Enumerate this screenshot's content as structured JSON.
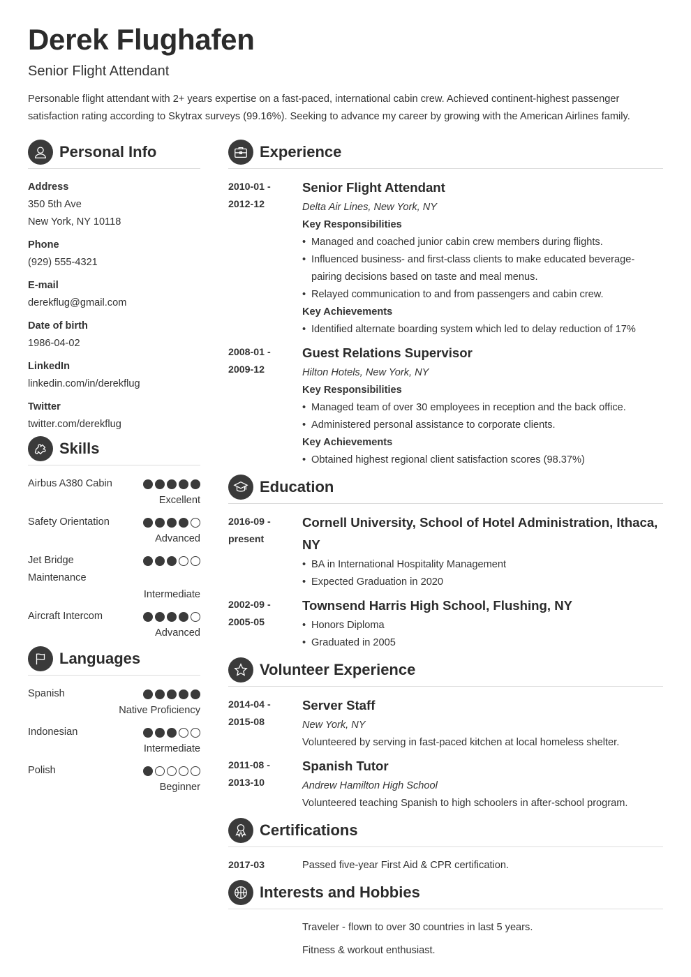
{
  "header": {
    "name": "Derek Flughafen",
    "title": "Senior Flight Attendant",
    "summary": "Personable flight attendant with 2+ years expertise on a fast-paced, international cabin crew. Achieved continent-highest passenger satisfaction rating according to Skytrax surveys (99.16%). Seeking to advance my career by growing with the American Airlines family."
  },
  "personal_info": {
    "heading": "Personal Info",
    "icon": "user-icon",
    "items": [
      {
        "label": "Address",
        "lines": [
          "350 5th Ave",
          "New York, NY 10118"
        ]
      },
      {
        "label": "Phone",
        "lines": [
          "(929) 555-4321"
        ]
      },
      {
        "label": "E-mail",
        "lines": [
          "derekflug@gmail.com"
        ]
      },
      {
        "label": "Date of birth",
        "lines": [
          "1986-04-02"
        ]
      },
      {
        "label": "LinkedIn",
        "lines": [
          "linkedin.com/in/derekflug"
        ]
      },
      {
        "label": "Twitter",
        "lines": [
          "twitter.com/derekflug"
        ]
      }
    ]
  },
  "skills": {
    "heading": "Skills",
    "icon": "puzzle-icon",
    "max": 5,
    "items": [
      {
        "name": "Airbus A380 Cabin",
        "rating": 5,
        "level": "Excellent"
      },
      {
        "name": "Safety Orientation",
        "rating": 4,
        "level": "Advanced"
      },
      {
        "name": "Jet Bridge Maintenance",
        "rating": 3,
        "level": "Intermediate"
      },
      {
        "name": "Aircraft Intercom",
        "rating": 4,
        "level": "Advanced"
      }
    ]
  },
  "languages": {
    "heading": "Languages",
    "icon": "flag-icon",
    "max": 5,
    "items": [
      {
        "name": "Spanish",
        "rating": 5,
        "level": "Native Proficiency"
      },
      {
        "name": "Indonesian",
        "rating": 3,
        "level": "Intermediate"
      },
      {
        "name": "Polish",
        "rating": 1,
        "level": "Beginner"
      }
    ]
  },
  "experience": {
    "heading": "Experience",
    "icon": "briefcase-icon",
    "entries": [
      {
        "date_start": "2010-01 -",
        "date_end": "2012-12",
        "title": "Senior Flight Attendant",
        "subtitle": "Delta Air Lines, New York, NY",
        "resp_label": "Key Responsibilities",
        "responsibilities": [
          "Managed and coached junior cabin crew members during flights.",
          "Influenced business- and first-class clients to make educated beverage-pairing decisions based on taste and meal menus.",
          "Relayed communication to and from passengers and cabin crew."
        ],
        "ach_label": "Key Achievements",
        "achievements": [
          "Identified alternate boarding system which led to delay reduction of 17%"
        ]
      },
      {
        "date_start": "2008-01 -",
        "date_end": "2009-12",
        "title": "Guest Relations Supervisor",
        "subtitle": "Hilton Hotels, New York, NY",
        "resp_label": "Key Responsibilities",
        "responsibilities": [
          "Managed team of over 30 employees in reception and the back office.",
          "Administered personal assistance to corporate clients."
        ],
        "ach_label": "Key Achievements",
        "achievements": [
          "Obtained highest regional client satisfaction scores (98.37%)"
        ]
      }
    ]
  },
  "education": {
    "heading": "Education",
    "icon": "graduation-cap-icon",
    "entries": [
      {
        "date_start": "2016-09 -",
        "date_end": "present",
        "title": "Cornell University, School of Hotel Administration, Ithaca, NY",
        "bullets": [
          "BA in International Hospitality Management",
          "Expected Graduation in 2020"
        ]
      },
      {
        "date_start": "2002-09 -",
        "date_end": "2005-05",
        "title": "Townsend Harris High School, Flushing, NY",
        "bullets": [
          "Honors Diploma",
          "Graduated in 2005"
        ]
      }
    ]
  },
  "volunteer": {
    "heading": "Volunteer Experience",
    "icon": "star-icon",
    "entries": [
      {
        "date_start": "2014-04 -",
        "date_end": "2015-08",
        "title": "Server Staff",
        "subtitle": "New York, NY",
        "text": "Volunteered by serving in fast-paced kitchen at local homeless shelter."
      },
      {
        "date_start": "2011-08 -",
        "date_end": "2013-10",
        "title": "Spanish Tutor",
        "subtitle": "Andrew Hamilton High School",
        "text": "Volunteered teaching Spanish to high schoolers in after-school program."
      }
    ]
  },
  "certifications": {
    "heading": "Certifications",
    "icon": "award-ribbon-icon",
    "entries": [
      {
        "date": "2017-03",
        "text": "Passed five-year First Aid & CPR certification."
      }
    ]
  },
  "interests": {
    "heading": "Interests and Hobbies",
    "icon": "basketball-icon",
    "items": [
      "Traveler - flown to over 30 countries in last 5 years.",
      "Fitness & workout enthusiast."
    ]
  }
}
